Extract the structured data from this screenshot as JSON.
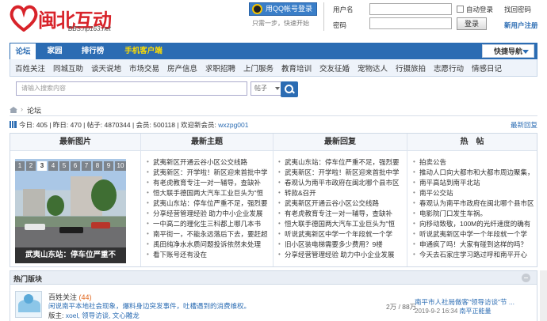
{
  "header": {
    "logo_text": "闽北互动",
    "logo_domain": "BBS.np163.net",
    "qq_login_label": "用QQ帐号登录",
    "qq_tip": "只需一步，快速开始",
    "username_label": "用户名",
    "password_label": "密码",
    "auto_login_label": "自动登录",
    "forgot_password": "找回密码",
    "login_button": "登录",
    "register": "新用户注册"
  },
  "nav": {
    "items": [
      "论坛",
      "家园",
      "排行榜",
      "手机客户端"
    ],
    "quick_nav": "快捷导航"
  },
  "subnav": {
    "items": [
      "百姓关注",
      "同城互助",
      "谈天说地",
      "市场交易",
      "房产信息",
      "求职招聘",
      "上门服务",
      "教育培训",
      "交友征婚",
      "宠物达人",
      "行摄旅拍",
      "志愿行动",
      "情感日记"
    ]
  },
  "search": {
    "placeholder": "请输入搜索内容",
    "scope": "帖子"
  },
  "breadcrumb": {
    "current": "论坛"
  },
  "stats": {
    "today_label": "今日:",
    "today": "405",
    "yesterday_label": "昨日:",
    "yesterday": "470",
    "posts_label": "帖子:",
    "posts": "4870344",
    "members_label": "会员:",
    "members": "500118",
    "welcome_label": "欢迎新会员:",
    "new_member": "wxzpg001",
    "latest_reply": "最新回复"
  },
  "panel": {
    "headers": [
      "最新图片",
      "最新主题",
      "最新回复",
      "热　帖"
    ],
    "pager": [
      "1",
      "2",
      "3",
      "4",
      "5",
      "6",
      "7",
      "8",
      "9",
      "10"
    ],
    "pager_active": 2,
    "photo_caption": "武夷山东站：停车位严重不",
    "latest_topics": [
      "武夷新区开通云谷小区公交线路",
      "武夷新区：开学啦！新区迎来首批中学",
      "有老虎教育专注一对一辅导，查缺补",
      "恒大联手德国两大汽车工业巨头为\"恒",
      "武夷山东站：停车位严重不足，强烈要",
      "分享经营管理经验 助力中小企业发展",
      "一中高二的理化生三科都上哪几本书",
      "南平街一，不能永远落后下去，要赶超",
      "禹田纯净水水质问题投诉依然未处理",
      "看下账号还有没在"
    ],
    "latest_replies": [
      "武夷山东站：停车位严重不足，强烈要",
      "武夷新区：开学啦！新区迎来首批中学",
      "春观认为南平市政府在闽北哪个县市区",
      "转款&召开",
      "武夷新区开通云谷小区公交线路",
      "有老虎教育专注一对一辅导，查缺补",
      "恒大联手德国两大汽车工业巨头为\"恒",
      "听说武夷新区中学一个年段就一个学",
      "旧小区装电梯需要多少费用？9楼",
      "分享经营管理经验 助力中小企业发展"
    ],
    "hot_posts": [
      "拍卖公告",
      "推动人口向大都市和大都市周边聚集，",
      "南平高站到南平北站",
      "南平公交站",
      "春观认为南平市政府在闽北哪个县市区",
      "电影院门口发生车祸。",
      "向移动致敬，100M的光纤速度的确有",
      "听说武夷新区中学一个年段就一个学",
      "申通疯了吗！大家有碰到这样的吗？",
      "今天去石家庄学习路过呼和南平开心"
    ]
  },
  "hot_forums": {
    "title": "热门版块",
    "forum": {
      "name": "百姓关注",
      "count": "(44)",
      "desc": "闲说南平本地社会现象，爆料身边突发事件，吐槽遇到的消费维权。",
      "mod_label": "版主:",
      "mods": "xoel, 领导访谈, 文心雕龙",
      "threads_posts": "2万 / 88万",
      "last_post": "南平市人社局做客\"领导访谈\"节 ...",
      "last_time": "2019-9-2 16:34",
      "last_user": "南平正能量"
    }
  }
}
